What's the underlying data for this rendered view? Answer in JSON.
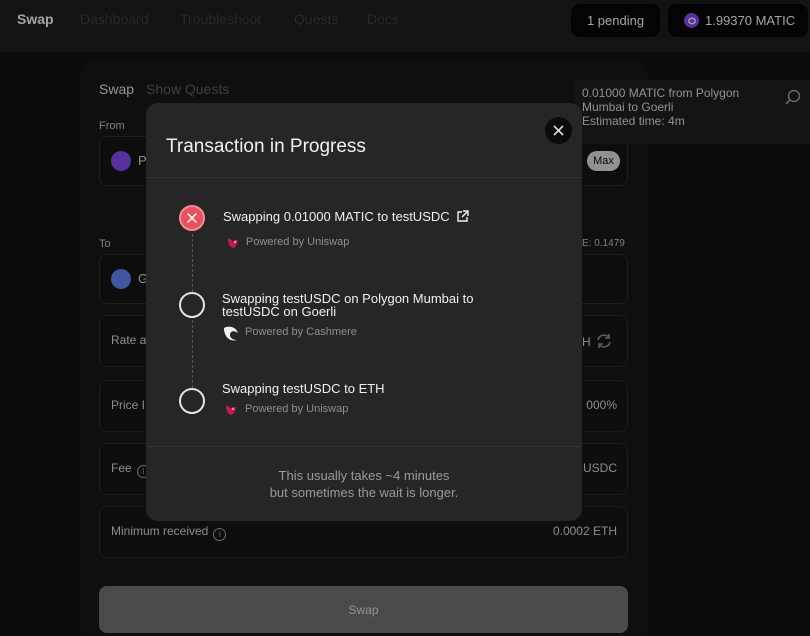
{
  "nav": {
    "brand": "Swap",
    "links": [
      "Dashboard",
      "Troubleshoot",
      "Quests",
      "Docs"
    ],
    "pending": "1 pending",
    "balance": "1.99370 MATIC"
  },
  "swap_card": {
    "tab_swap": "Swap",
    "tab_quests": "Show Quests",
    "from_label": "From",
    "from_token_partial": "P",
    "max_label": "Max",
    "to_label": "To",
    "to_token_partial": "G",
    "balance_partial": "E: 0.1479",
    "rate_label": "Rate a",
    "rate_value_partial": "H",
    "price_label": "Price I",
    "price_value": "000%",
    "fee_label": "Fee",
    "fee_value": "USDC",
    "min_received_label": "Minimum received",
    "min_received_value": "0.0002 ETH",
    "swap_button": "Swap"
  },
  "toast": {
    "line1": "0.01000 MATIC from Polygon Mumbai to Goerli",
    "line2": "Estimated time: 4m"
  },
  "modal": {
    "title": "Transaction in Progress",
    "steps": [
      {
        "title": "Swapping 0.01000 MATIC to testUSDC",
        "sub": "Powered by Uniswap",
        "status": "error"
      },
      {
        "title_line1": "Swapping testUSDC on Polygon Mumbai to",
        "title_line2": "testUSDC on Goerli",
        "sub": "Powered by Cashmere",
        "status": "pending"
      },
      {
        "title": "Swapping testUSDC to ETH",
        "sub": "Powered by Uniswap",
        "status": "pending"
      }
    ],
    "footer_line1": "This usually takes ~4 minutes",
    "footer_line2": "but sometimes the wait is longer."
  },
  "colors": {
    "error": "#e8525f",
    "matic": "#8247e5",
    "eth": "#627eea",
    "uniswap": "#ff007a"
  }
}
